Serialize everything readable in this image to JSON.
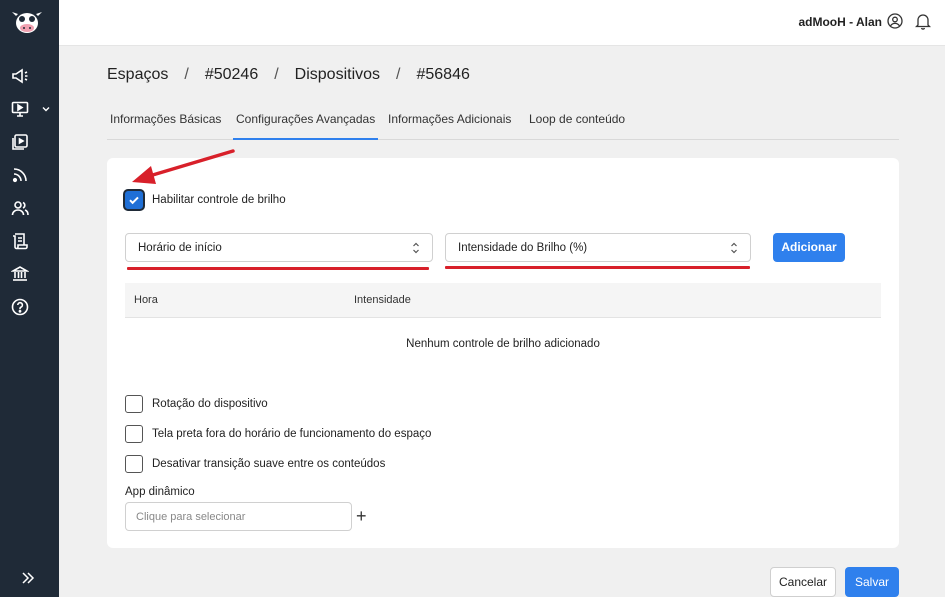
{
  "topbar": {
    "user_name": "adMooH - Alan"
  },
  "breadcrumb": {
    "items": [
      "Espaços",
      "#50246",
      "Dispositivos",
      "#56846"
    ],
    "separator": "/"
  },
  "tabs": [
    {
      "label": "Informações Básicas",
      "active": false
    },
    {
      "label": "Configurações Avançadas",
      "active": true
    },
    {
      "label": "Informações Adicionais",
      "active": false
    },
    {
      "label": "Loop de conteúdo",
      "active": false
    }
  ],
  "brightness": {
    "enable_label": "Habilitar controle de brilho",
    "enabled": true,
    "start_select": "Horário de início",
    "intensity_select": "Intensidade do Brilho (%)",
    "add_button": "Adicionar",
    "columns": [
      "Hora",
      "Intensidade"
    ],
    "empty_message": "Nenhum controle de brilho adicionado"
  },
  "options": [
    {
      "label": "Rotação do dispositivo",
      "checked": false
    },
    {
      "label": "Tela preta fora do horário de funcionamento do espaço",
      "checked": false
    },
    {
      "label": "Desativar transição suave entre os conteúdos",
      "checked": false
    }
  ],
  "dynamic_app": {
    "label": "App dinâmico",
    "placeholder": "Clique para selecionar",
    "add_symbol": "+"
  },
  "footer": {
    "cancel": "Cancelar",
    "save": "Salvar"
  },
  "colors": {
    "accent": "#2f80ed",
    "sidebar": "#1f2a37",
    "annotation": "#d8202a"
  },
  "icons": [
    "cow-logo",
    "megaphone-icon",
    "screen-play-icon",
    "playlist-icon",
    "rss-icon",
    "users-icon",
    "receipt-icon",
    "bank-icon",
    "help-icon",
    "expand-icon",
    "user-circle-icon",
    "bell-icon"
  ]
}
